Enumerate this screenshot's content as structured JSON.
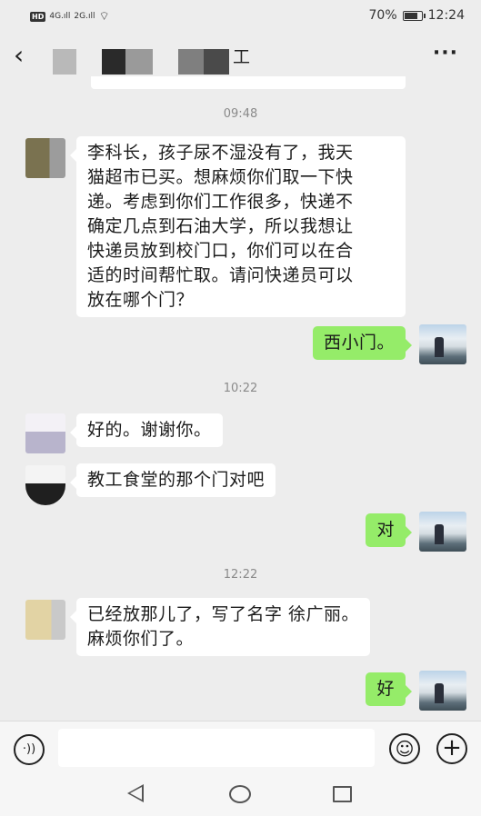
{
  "status_bar": {
    "hd_label": "HD",
    "signal_1": "4G",
    "signal_2": "2G",
    "battery_percent": "70%",
    "battery_level": 0.7,
    "time": "12:24"
  },
  "header": {
    "back_icon": "chevron-left-icon",
    "title_visible_char": "工",
    "more_icon": "ellipsis-icon",
    "more_label": "···"
  },
  "messages": [
    {
      "type": "time",
      "text": "09:48"
    },
    {
      "type": "in",
      "text_lines": [
        "李科长，孩子尿不湿没有了，我天",
        "猫超市已买。想麻烦你们取一下快",
        "递。考虑到你们工作很多，快递不",
        "确定几点到石油大学，所以我想让",
        "快递员放到校门口，你们可以在合",
        "适的时间帮忙取。请问快递员可以",
        "放在哪个门？"
      ]
    },
    {
      "type": "out",
      "text": "西小门。"
    },
    {
      "type": "time",
      "text": "10:22"
    },
    {
      "type": "in",
      "text": "好的。谢谢你。"
    },
    {
      "type": "in",
      "text": "教工食堂的那个门对吧"
    },
    {
      "type": "out",
      "text": "对"
    },
    {
      "type": "time",
      "text": "12:22"
    },
    {
      "type": "in",
      "text_lines": [
        "已经放那儿了，写了名字 徐广丽。",
        "麻烦你们了。"
      ]
    },
    {
      "type": "out",
      "text": "好"
    }
  ],
  "input_bar": {
    "voice_icon": "voice-icon",
    "voice_glyph": "·))",
    "input_value": "",
    "emoji_icon": "emoji-icon",
    "emoji_glyph": "☺",
    "plus_icon": "plus-icon",
    "plus_glyph": "+"
  },
  "nav_bar": {
    "back_icon": "triangle-back-icon",
    "home_icon": "circle-home-icon",
    "recent_icon": "square-recents-icon"
  },
  "colors": {
    "background": "#ededed",
    "incoming_bubble": "#ffffff",
    "outgoing_bubble": "#95ec69",
    "timestamp": "#8a8a8a"
  }
}
